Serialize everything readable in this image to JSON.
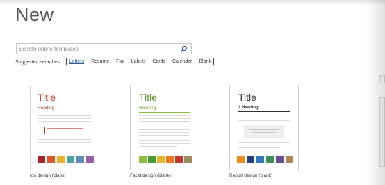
{
  "header": {
    "title": "New"
  },
  "search": {
    "placeholder": "Search online templates"
  },
  "suggested": {
    "label": "Suggested searches:",
    "links": [
      "Letters",
      "Resume",
      "Fax",
      "Labels",
      "Cards",
      "Calendar",
      "Blank"
    ]
  },
  "templates": [
    {
      "name": "Ion design (blank)",
      "preview_title": "Title",
      "preview_heading": "Heading",
      "title_color": "#b03a2e",
      "heading_color": "#b03a2e",
      "swatches": [
        "#a4262c",
        "#e0572b",
        "#efb029",
        "#4aa5a0",
        "#5b8fb9",
        "#9c5ea8"
      ]
    },
    {
      "name": "Facet design (blank)",
      "preview_title": "Title",
      "preview_heading": "Heading",
      "title_color": "#5f8f2a",
      "heading_color": "#6f9f2f",
      "swatches": [
        "#8fbf3f",
        "#4a9a3a",
        "#e7b52a",
        "#e97a24",
        "#c0392b",
        "#9a8f5a"
      ]
    },
    {
      "name": "Report design (blank)",
      "preview_title": "Title",
      "preview_heading": "1 Heading",
      "title_color": "#333333",
      "heading_color": "#333333",
      "swatches": [
        "#ee8b1c",
        "#243f7a",
        "#2f79b9",
        "#3f8f5a",
        "#6a4f8f",
        "#b08850"
      ]
    }
  ]
}
